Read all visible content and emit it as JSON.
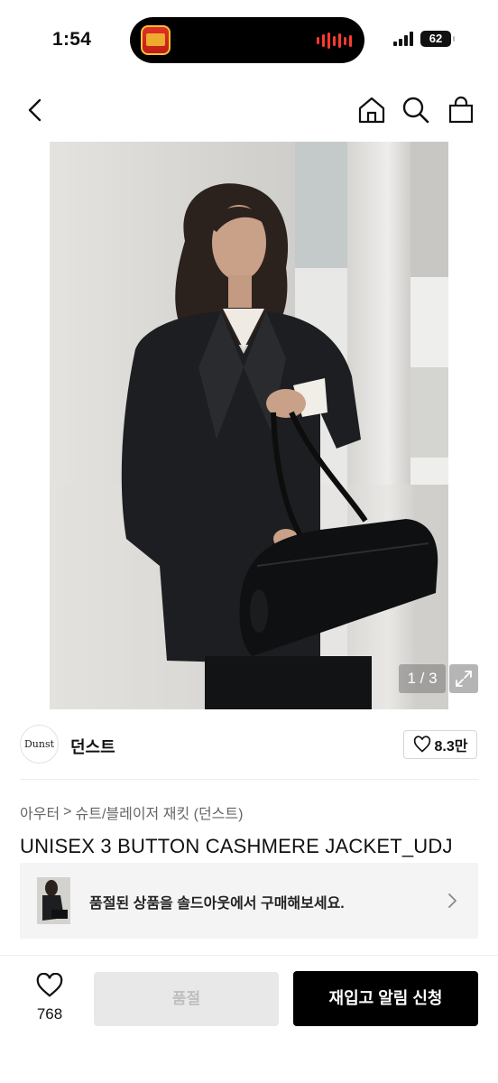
{
  "status_bar": {
    "time": "1:54",
    "battery": "62"
  },
  "hero": {
    "pager": "1 / 3"
  },
  "brand": {
    "logo_text": "Dunst",
    "name": "던스트",
    "likes": "8.3만"
  },
  "category": {
    "level1": "아우터",
    "separator": ">",
    "level2": "슈트/블레이저 재킷 (던스트)"
  },
  "product": {
    "title": "UNISEX 3 BUTTON CASHMERE JACKET_UDJ"
  },
  "banner": {
    "text": "품절된 상품을 솔드아웃에서 구매해보세요."
  },
  "bottom_bar": {
    "wish_count": "768",
    "soldout_label": "품절",
    "restock_label": "재입고 알림 신청"
  },
  "colors": {
    "primary_button": "#000000",
    "disabled_button": "#e8e8e8",
    "island_wave": "#ff3b30"
  },
  "icons": [
    "back-icon",
    "home-icon",
    "search-icon",
    "bag-icon",
    "heart-icon",
    "expand-icon",
    "chevron-right-icon"
  ]
}
